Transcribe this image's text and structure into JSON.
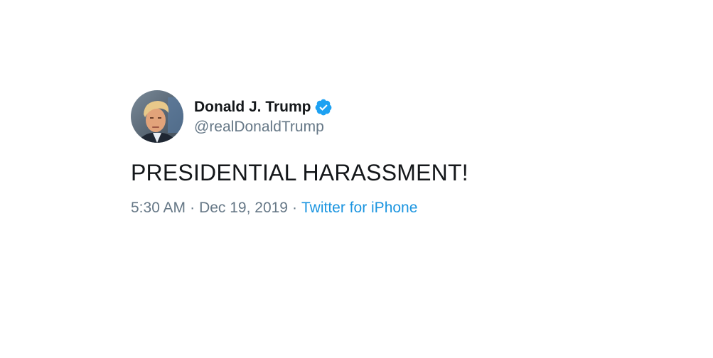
{
  "tweet": {
    "author": {
      "display_name": "Donald J. Trump",
      "handle": "@realDonaldTrump",
      "verified": true,
      "avatar_icon": "profile-photo",
      "verified_icon": "verified-badge-icon"
    },
    "text": "PRESIDENTIAL HARASSMENT!",
    "timestamp": {
      "time": "5:30 AM",
      "separator": "·",
      "date": "Dec 19, 2019"
    },
    "source": "Twitter for iPhone"
  },
  "colors": {
    "text_primary": "#14171a",
    "text_secondary": "#657786",
    "link": "#1b95e0",
    "verified_badge": "#1da1f2"
  }
}
